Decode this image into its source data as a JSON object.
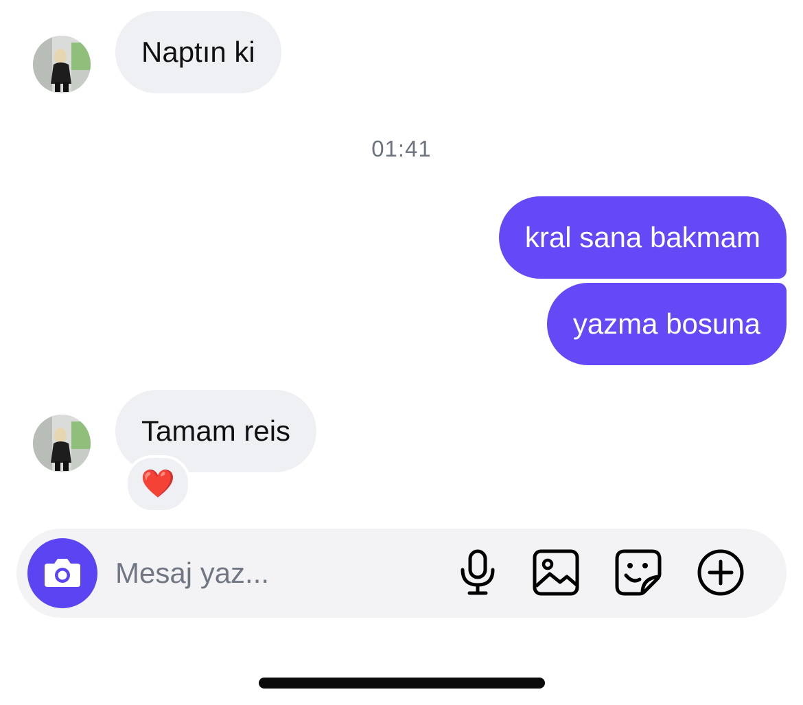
{
  "conversation": {
    "messages": [
      {
        "direction": "incoming",
        "text": "Naptın ki"
      },
      {
        "direction": "outgoing",
        "text": "kral sana bakmam"
      },
      {
        "direction": "outgoing",
        "text": "yazma bosuna"
      },
      {
        "direction": "incoming",
        "text": "Tamam reis",
        "reaction": "❤️"
      }
    ],
    "timestamp": "01:41"
  },
  "composer": {
    "placeholder": "Mesaj yaz...",
    "value": "",
    "buttons": [
      {
        "icon": "camera-icon"
      },
      {
        "icon": "microphone-icon"
      },
      {
        "icon": "image-icon"
      },
      {
        "icon": "sticker-icon"
      },
      {
        "icon": "plus-circle-icon"
      }
    ]
  },
  "colors": {
    "outgoing_bubble": "#6549f7",
    "incoming_bubble": "#eff0f4",
    "camera_button": "#5b45f2",
    "composer_bg": "#f3f3f5",
    "timestamp_text": "#6d7480"
  }
}
